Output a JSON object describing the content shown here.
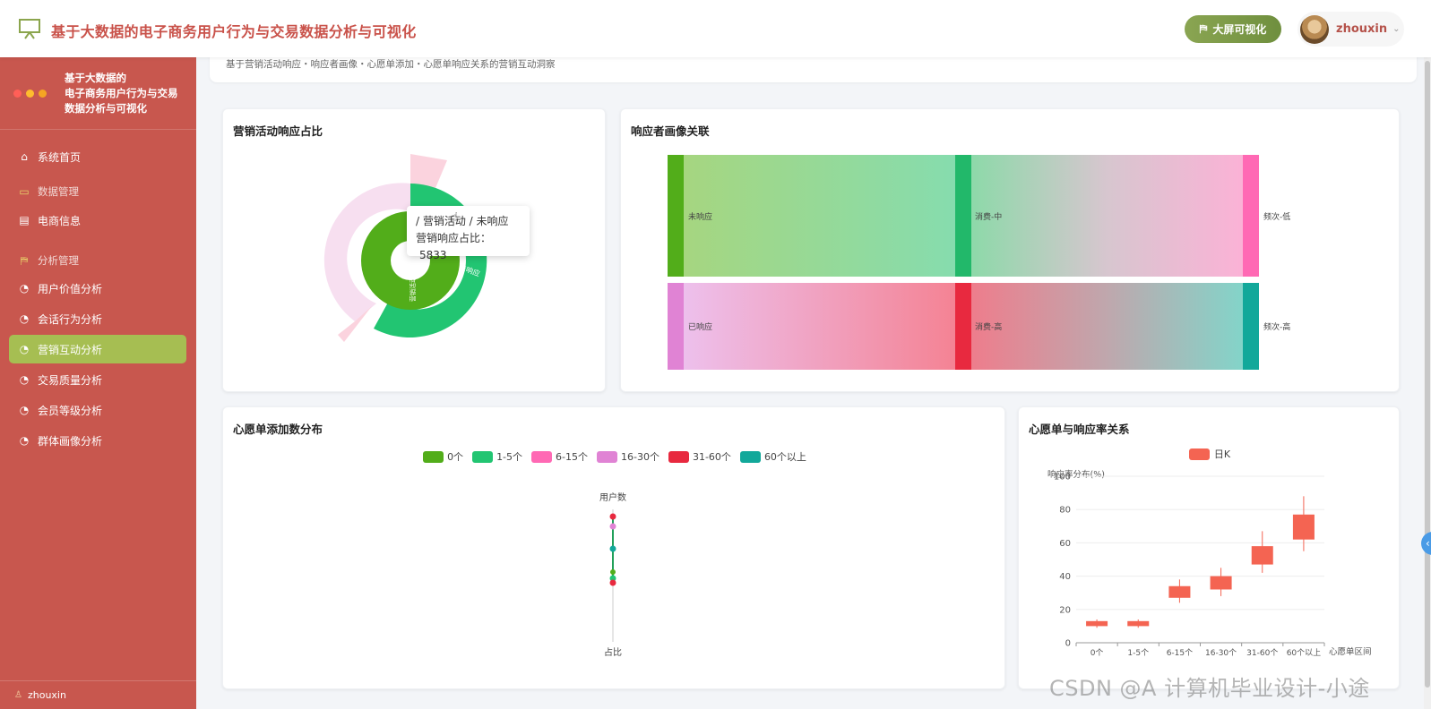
{
  "header": {
    "title": "基于大数据的电子商务用户行为与交易数据分析与可视化",
    "bigscreen_label": "大屏可视化",
    "user_name": "zhouxin"
  },
  "sidebar": {
    "title": "基于大数据的\n电子商务用户行为与交易数据分析与可视化",
    "items": [
      {
        "label": "系统首页",
        "icon": "home-icon"
      },
      {
        "label": "数据管理",
        "icon": "folder-icon",
        "group": true
      },
      {
        "label": "电商信息",
        "icon": "document-icon"
      },
      {
        "label": "分析管理",
        "icon": "chart-icon",
        "group": true
      },
      {
        "label": "用户价值分析",
        "icon": "pie-icon"
      },
      {
        "label": "会话行为分析",
        "icon": "pie-icon"
      },
      {
        "label": "营销互动分析",
        "icon": "pie-icon",
        "active": true
      },
      {
        "label": "交易质量分析",
        "icon": "pie-icon"
      },
      {
        "label": "会员等级分析",
        "icon": "pie-icon"
      },
      {
        "label": "群体画像分析",
        "icon": "pie-icon"
      }
    ],
    "footer_user": "zhouxin"
  },
  "banner": {
    "text": "基于营销活动响应・响应者画像・心愿单添加・心愿单响应关系的营销互动洞察"
  },
  "cards": {
    "pie_title": "营销活动响应占比",
    "sankey_title": "响应者画像关联",
    "wish_title": "心愿单添加数分布",
    "kline_title": "心愿单与响应率关系"
  },
  "pie": {
    "tooltip_path": "/ 营销活动 / 未响应",
    "tooltip_label": "营销响应占比",
    "tooltip_value": "5833",
    "inner_label_a": "未响应",
    "inner_label_b": "营销活动",
    "colors": {
      "green_dark": "#52ad1a",
      "green": "#22c572",
      "pink": "#f7dff0",
      "pink2": "#fbd3de"
    }
  },
  "sankey": {
    "nodes_left": [
      "未响应",
      "已响应"
    ],
    "nodes_mid": [
      "消费-中",
      "消费-高"
    ],
    "nodes_right": [
      "频次-低",
      "频次-高"
    ]
  },
  "wish": {
    "legend": [
      "0个",
      "1-5个",
      "6-15个",
      "16-30个",
      "31-60个",
      "60个以上"
    ],
    "legend_colors": [
      "#52ad1a",
      "#22c572",
      "#ff69b4",
      "#e083d4",
      "#e8293f",
      "#12a89a"
    ],
    "axis_top": "用户数",
    "axis_bottom": "占比"
  },
  "chart_data": {
    "type": "candlestick",
    "title": "心愿单与响应率关系",
    "legend": [
      "日K"
    ],
    "xlabel": "心愿单区间",
    "ylabel": "响应率分布(%)",
    "ylim": [
      0,
      100
    ],
    "yticks": [
      0,
      20,
      40,
      60,
      80,
      100
    ],
    "categories": [
      "0个",
      "1-5个",
      "6-15个",
      "16-30个",
      "31-60个",
      "60个以上"
    ],
    "series": [
      {
        "values": [
          {
            "open": 10,
            "close": 13,
            "low": 9,
            "high": 14
          },
          {
            "open": 10,
            "close": 13,
            "low": 9,
            "high": 14
          },
          {
            "open": 27,
            "close": 34,
            "low": 24,
            "high": 38
          },
          {
            "open": 32,
            "close": 40,
            "low": 28,
            "high": 45
          },
          {
            "open": 47,
            "close": 58,
            "low": 42,
            "high": 67
          },
          {
            "open": 62,
            "close": 77,
            "low": 55,
            "high": 88
          }
        ]
      }
    ],
    "color": "#f46452"
  },
  "watermark": "CSDN @A 计算机毕业设计-小途"
}
